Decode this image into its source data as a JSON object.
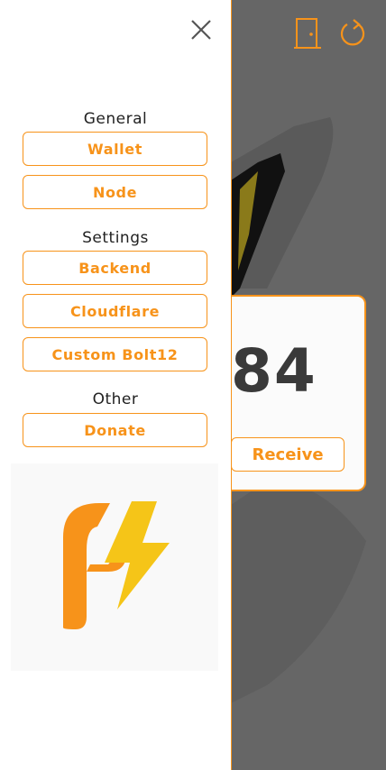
{
  "colors": {
    "accent": "#f7931a",
    "bolt": "#f5c518",
    "background_overlay": "#666666"
  },
  "drawer": {
    "close_icon": "close-icon",
    "sections": [
      {
        "title": "General",
        "items": [
          "Wallet",
          "Node"
        ]
      },
      {
        "title": "Settings",
        "items": [
          "Backend",
          "Cloudflare",
          "Custom Bolt12"
        ]
      },
      {
        "title": "Other",
        "items": [
          "Donate"
        ]
      }
    ]
  },
  "header": {
    "icons": [
      "door-exit-icon",
      "refresh-icon"
    ]
  },
  "card": {
    "balance": "84",
    "receive_label": "Receive"
  }
}
